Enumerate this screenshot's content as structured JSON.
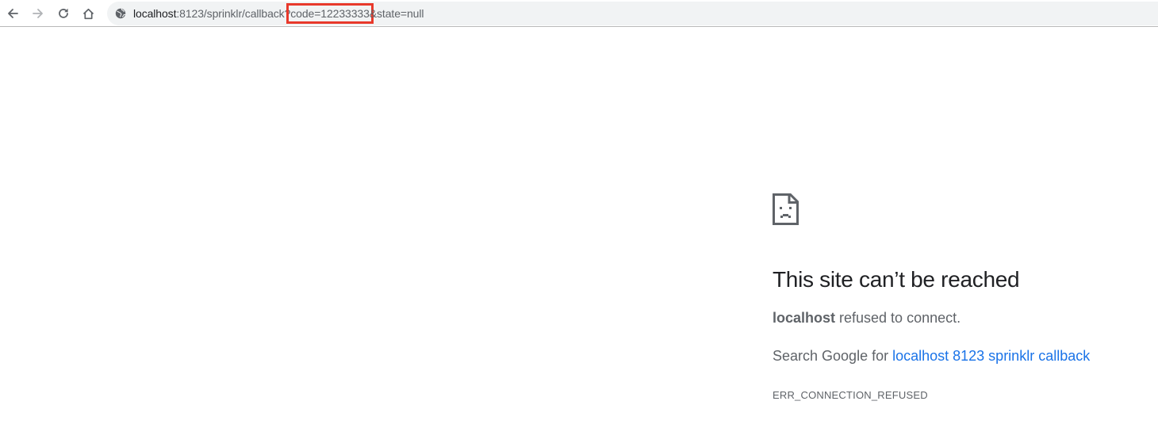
{
  "toolbar": {
    "back_icon": "back-arrow-icon",
    "forward_icon": "forward-arrow-icon",
    "reload_icon": "reload-icon",
    "home_icon": "home-icon",
    "site_info_icon": "globe-icon"
  },
  "omnibox": {
    "host": "localhost",
    "path_prefix": ":8123/sprinklr/callback?",
    "highlighted": "code=12233333",
    "path_suffix": "&state=null",
    "highlight_color": "#e8392b"
  },
  "error_page": {
    "icon": "sad-page-icon",
    "title": "This site can’t be reached",
    "host_bold": "localhost",
    "message": " refused to connect.",
    "search_prefix": "Search Google for ",
    "search_link": "localhost 8123 sprinklr callback",
    "error_code": "ERR_CONNECTION_REFUSED",
    "link_color": "#1a73e8"
  }
}
